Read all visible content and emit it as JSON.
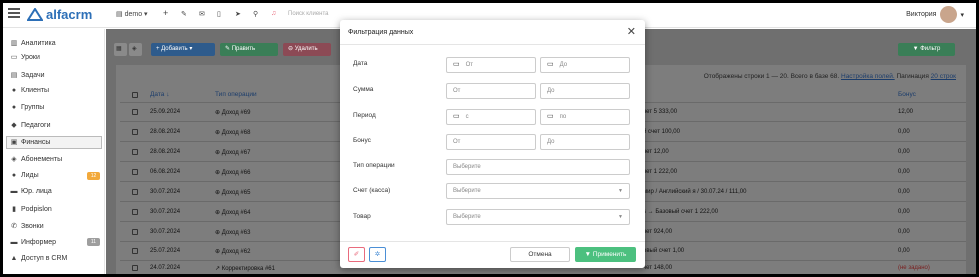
{
  "app": {
    "logo": "alfacrm"
  },
  "topbar": {
    "branch": "demo",
    "search_placeholder": "Поиск клиента",
    "user_name": "Виктория"
  },
  "sidebar": {
    "items": [
      {
        "label": "Аналитика",
        "icon": "chart-icon"
      },
      {
        "label": "Уроки",
        "icon": "calendar-icon"
      },
      {
        "label": "Задачи",
        "icon": "tasks-icon"
      },
      {
        "label": "Клиенты",
        "icon": "user-icon"
      },
      {
        "label": "Группы",
        "icon": "users-icon"
      },
      {
        "label": "Педагоги",
        "icon": "graduation-icon"
      },
      {
        "label": "Финансы",
        "icon": "money-icon"
      },
      {
        "label": "Абонементы",
        "icon": "tag-icon"
      },
      {
        "label": "Лиды",
        "icon": "lead-icon",
        "badge": "12"
      },
      {
        "label": "Юр. лица",
        "icon": "card-icon"
      },
      {
        "label": "Podpislon",
        "icon": "doc-icon"
      },
      {
        "label": "Звонки",
        "icon": "phone-icon"
      },
      {
        "label": "Информер",
        "icon": "inbox-icon",
        "badge": "11"
      },
      {
        "label": "Доступ в CRM",
        "icon": "lock-icon"
      }
    ]
  },
  "toolbar": {
    "add_label": "+ Добавить ▾",
    "edit_label": "✎ Править",
    "delete_label": "⊖ Удалить",
    "filter_label": "▼ Фильтр"
  },
  "table": {
    "info": "Отображены строки 1 — 20. Всего в базе 68.",
    "settings_link": "Настройка полей.",
    "pagination_label": "Пагинация",
    "pagination_value": "20 строк",
    "headers": {
      "date": "Дата ↓",
      "type": "Тип операции",
      "bonus": "Бонус"
    },
    "rows": [
      {
        "date": "25.09.2024",
        "type": "⊕ Доход #69",
        "desc": "чет 5 333,00",
        "bonus": "12,00"
      },
      {
        "date": "28.08.2024",
        "type": "⊕ Доход #68",
        "desc": "й счет 100,00",
        "bonus": "0,00"
      },
      {
        "date": "28.08.2024",
        "type": "⊕ Доход #67",
        "desc": "чет 12,00",
        "bonus": "0,00"
      },
      {
        "date": "06.08.2024",
        "type": "⊕ Доход #66",
        "desc": "чет 1 222,00",
        "bonus": "0,00"
      },
      {
        "date": "30.07.2024",
        "type": "⊕ Доход #65",
        "desc": "мир / Английский я / 30.07.24 / 111,00",
        "bonus": "0,00"
      },
      {
        "date": "30.07.2024",
        "type": "⊕ Доход #64",
        "desc": "s → Базовый счет 1 222,00",
        "bonus": "0,00"
      },
      {
        "date": "30.07.2024",
        "type": "⊕ Доход #63",
        "desc": "чет 924,00",
        "bonus": "0,00"
      },
      {
        "date": "25.07.2024",
        "type": "⊕ Доход #62",
        "desc": "овый счет 1,00",
        "bonus": "0,00"
      },
      {
        "date": "24.07.2024",
        "type": "↗ Корректировка #61",
        "desc": "чет 148,00",
        "bonus": "(не задано)"
      }
    ]
  },
  "modal": {
    "title": "Фильтрация данных",
    "fields": {
      "date_label": "Дата",
      "date_from": "От",
      "date_to": "До",
      "sum_label": "Сумма",
      "sum_from": "От",
      "sum_to": "До",
      "period_label": "Период",
      "period_from": "с",
      "period_to": "по",
      "bonus_label": "Бонус",
      "bonus_from": "От",
      "bonus_to": "До",
      "optype_label": "Тип операции",
      "optype_placeholder": "Выберите",
      "account_label": "Счет (касса)",
      "account_placeholder": "Выберите",
      "product_label": "Товар",
      "product_placeholder": "Выберите"
    },
    "cancel_label": "Отмена",
    "apply_label": "▼ Применить"
  },
  "colors": {
    "brand": "#2c6fb7",
    "primary_button": "#4b8fd6",
    "success_button": "#4cc07f",
    "danger_button": "#e96b7d",
    "badge_orange": "#f2a93b",
    "badge_gray": "#9e9e9e"
  }
}
